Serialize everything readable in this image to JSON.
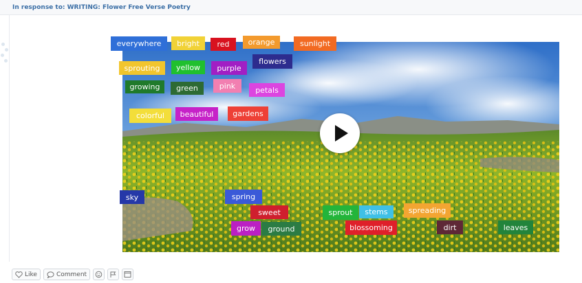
{
  "header": {
    "title": "In response to: WRITING: Flower Free Verse Poetry"
  },
  "video": {
    "play_icon": "play-icon"
  },
  "word_tags": [
    {
      "text": "everywhere",
      "color": "#2f6fd8"
    },
    {
      "text": "bright",
      "color": "#f1d236"
    },
    {
      "text": "red",
      "color": "#d8121f"
    },
    {
      "text": "orange",
      "color": "#f39a2d"
    },
    {
      "text": "sunlight",
      "color": "#f26a22"
    },
    {
      "text": "sprouting",
      "color": "#f1c52e"
    },
    {
      "text": "yellow",
      "color": "#20c02e"
    },
    {
      "text": "purple",
      "color": "#a11fc4"
    },
    {
      "text": "flowers",
      "color": "#2d2c8e"
    },
    {
      "text": "growing",
      "color": "#1f7a2b"
    },
    {
      "text": "green",
      "color": "#2d6a33"
    },
    {
      "text": "pink",
      "color": "#f27fb1"
    },
    {
      "text": "petals",
      "color": "#dc45e0"
    },
    {
      "text": "colorful",
      "color": "#f3de3a"
    },
    {
      "text": "beautiful",
      "color": "#c622c8"
    },
    {
      "text": "gardens",
      "color": "#ee4036"
    },
    {
      "text": "sky",
      "color": "#2538a8"
    },
    {
      "text": "spring",
      "color": "#3a5ad8"
    },
    {
      "text": "sweet",
      "color": "#cf1f2e"
    },
    {
      "text": "sprout",
      "color": "#23b53a"
    },
    {
      "text": "stems",
      "color": "#3fc0e6"
    },
    {
      "text": "spreading",
      "color": "#f3a532"
    },
    {
      "text": "grow",
      "color": "#bb20c3"
    },
    {
      "text": "ground",
      "color": "#2b7c44"
    },
    {
      "text": "blossoming",
      "color": "#df1f2a"
    },
    {
      "text": "dirt",
      "color": "#5e2836"
    },
    {
      "text": "leaves",
      "color": "#22843b"
    }
  ],
  "actions": {
    "like_label": "Like",
    "comment_label": "Comment",
    "like_icon": "heart-icon",
    "comment_icon": "comment-bubble-icon",
    "extra_icons": [
      "emoji-icon",
      "flag-icon",
      "window-icon"
    ]
  }
}
